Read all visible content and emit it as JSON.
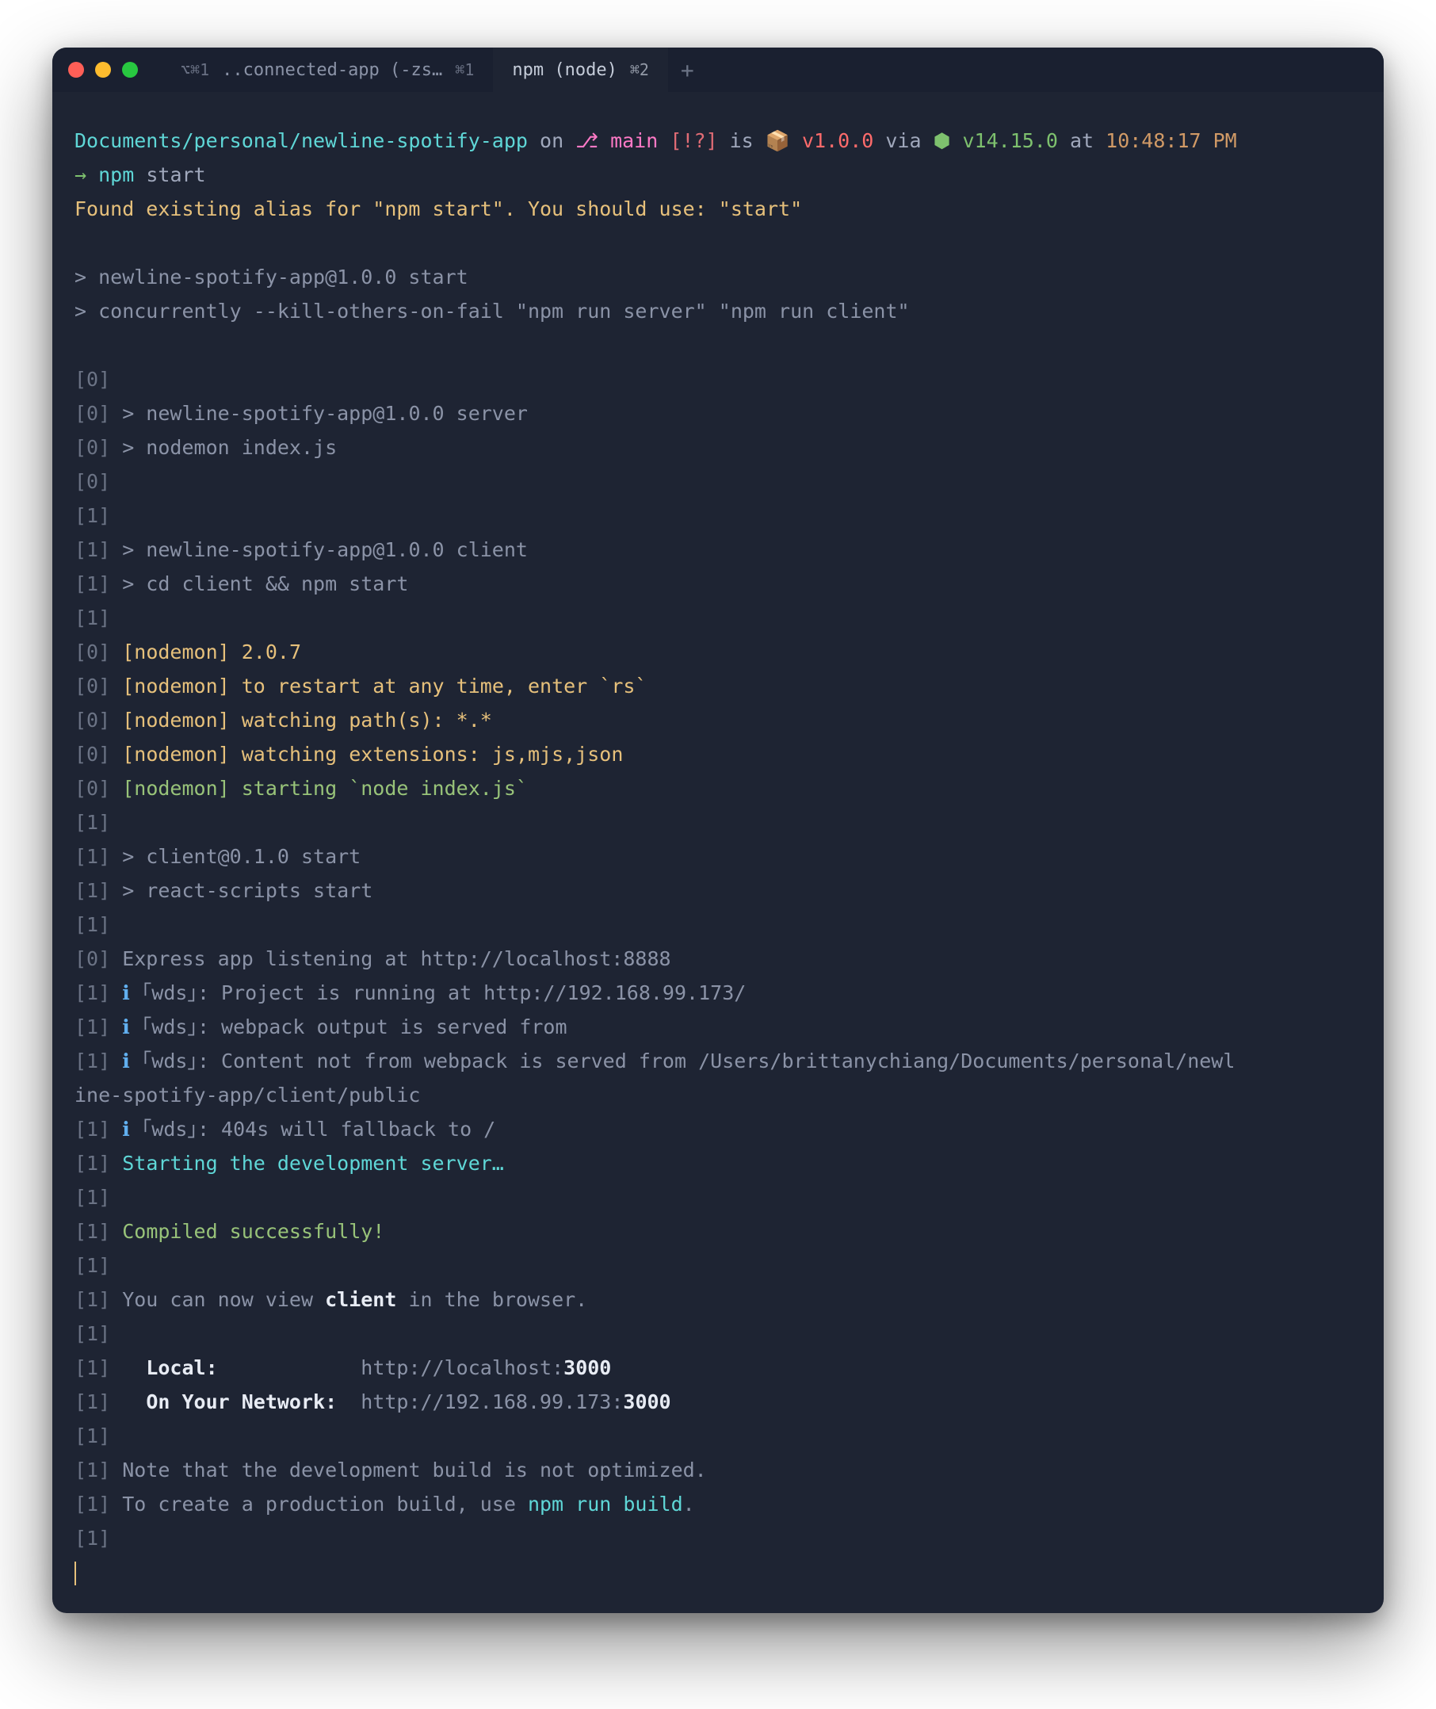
{
  "tabs": {
    "tab1": {
      "icon": "⌥⌘1",
      "label": "..connected-app (-zs…",
      "shortcut": "⌘1"
    },
    "tab2": {
      "label": "npm (node)",
      "shortcut": "⌘2"
    }
  },
  "prompt": {
    "path": "Documents/personal/newline-spotify-app",
    "on": "on",
    "branch_icon": "⎇",
    "branch": "main",
    "status": "[!?]",
    "is": "is",
    "pkg_icon": "📦",
    "version": "v1.0.0",
    "via": "via",
    "node_icon": "⬢",
    "node_version": "v14.15.0",
    "at": "at",
    "time": "10:48:17 PM",
    "arrow": "→",
    "cmd_npm": "npm",
    "cmd_start": "start"
  },
  "lines": {
    "alias": "Found existing alias for \"npm start\". You should use: \"start\"",
    "blank": " ",
    "script1": "> newline-spotify-app@1.0.0 start",
    "script2": "> concurrently --kill-others-on-fail \"npm run server\" \"npm run client\"",
    "p0": "[0]",
    "p1": "[1]",
    "server1": " > newline-spotify-app@1.0.0 server",
    "server2": " > nodemon index.js",
    "client1": " > newline-spotify-app@1.0.0 client",
    "client2": " > cd client && npm start",
    "nodemon_tag": "[nodemon]",
    "nodemon1": " 2.0.7",
    "nodemon2": " to restart at any time, enter `rs`",
    "nodemon3": " watching path(s): *.*",
    "nodemon4": " watching extensions: js,mjs,json",
    "nodemon5": " starting `node index.js`",
    "clientstart1": " > client@0.1.0 start",
    "clientstart2": " > react-scripts start",
    "express": " Express app listening at http://localhost:8888",
    "wds_i": " ℹ",
    "wds_tag": "｢wds｣",
    "wds1": ": Project is running at http://192.168.99.173/",
    "wds2": ": webpack output is served from ",
    "wds3a": ": Content not from webpack is served from /Users/brittanychiang/Documents/personal/newl",
    "wds3b": "ine-spotify-app/client/public",
    "wds4": ": 404s will fallback to /",
    "starting": "Starting the development server…",
    "compiled": "Compiled successfully!",
    "view1": " You can now view ",
    "view_client": "client",
    "view2": " in the browser.",
    "local_label": "Local:",
    "local_pad": "           ",
    "local_url": "http://localhost:",
    "local_port": "3000",
    "net_label": "On Your Network:",
    "net_pad": "  ",
    "net_url": "http://192.168.99.173:",
    "net_port": "3000",
    "note1": " Note that the development build is not optimized.",
    "note2a": " To create a production build, use ",
    "note2b": "npm run build",
    "note2c": "."
  }
}
